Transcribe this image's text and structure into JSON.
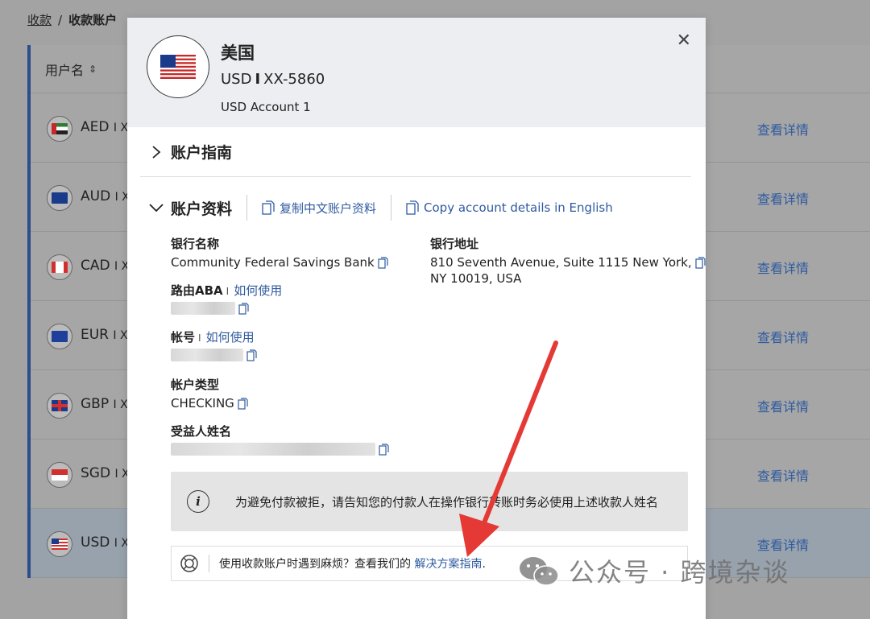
{
  "breadcrumb": {
    "link": "收款",
    "separator": "/",
    "current": "收款账户"
  },
  "table": {
    "header": {
      "username": "用户名",
      "sort_icon": "sort-icon"
    },
    "rows": [
      {
        "code": "AED",
        "suffix": "I X",
        "detail": "查看详情"
      },
      {
        "code": "AUD",
        "suffix": "I X",
        "detail": "查看详情"
      },
      {
        "code": "CAD",
        "suffix": "I X",
        "detail": "查看详情"
      },
      {
        "code": "EUR",
        "suffix": "I X",
        "detail": "查看详情"
      },
      {
        "code": "GBP",
        "suffix": "I X",
        "detail": "查看详情"
      },
      {
        "code": "SGD",
        "suffix": "I X",
        "detail": "查看详情"
      },
      {
        "code": "USD",
        "suffix": "I X",
        "detail": "查看详情"
      }
    ],
    "accent_color": "#2a4f8a"
  },
  "modal": {
    "country": "美国",
    "currency": "USD",
    "account_bar": "I",
    "account_number": "XX-5860",
    "account_name": "USD Account 1",
    "close_icon": "close-icon",
    "guide_title": "账户指南",
    "info_title": "账户资料",
    "copy_cn": "复制中文账户资料",
    "copy_en": "Copy account details in English",
    "fields": {
      "bank_name_label": "银行名称",
      "bank_name_value": "Community Federal Savings Bank",
      "bank_addr_label": "银行地址",
      "bank_addr_line1": "810 Seventh Avenue, Suite 1115 New York,",
      "bank_addr_line2": "NY 10019, USA",
      "aba_label": "路由ABA",
      "aba_how": "如何使用",
      "acct_label": "帐号",
      "acct_how": "如何使用",
      "type_label": "帐户类型",
      "type_value": "CHECKING",
      "beneficiary_label": "受益人姓名"
    },
    "notice": "为避免付款被拒，请告知您的付款人在操作银行转账时务必使用上述收款人姓名",
    "help_prefix": "使用收款账户时遇到麻烦？查看我们的 ",
    "help_link": "解决方案指南",
    "help_suffix": ".",
    "link_color": "#2f5ba0"
  },
  "watermark": {
    "text": "公众号 · 跨境杂谈"
  }
}
